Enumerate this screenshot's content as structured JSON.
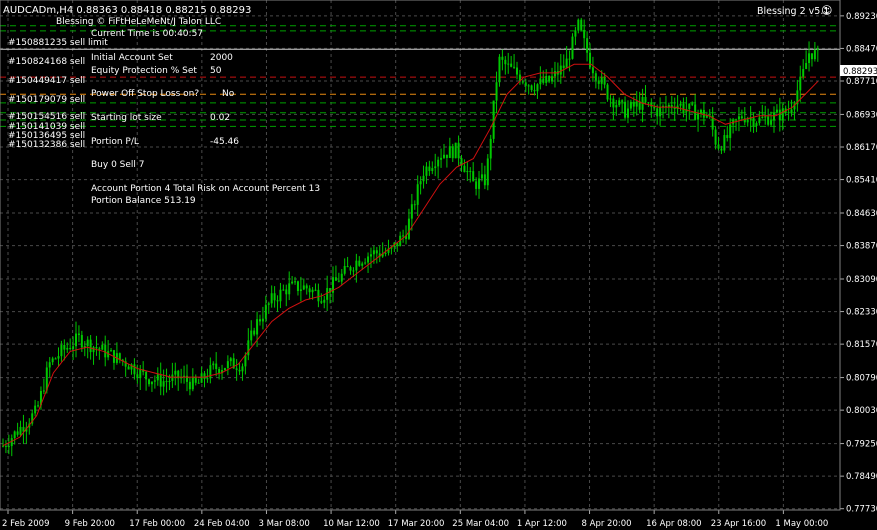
{
  "header": {
    "symbol_line": "AUDCADm,H4  0.88363 0.88418 0.88215 0.88293",
    "ea_credit": "Blessing © FiFtHeLeMeNt/J Talon LLC",
    "ea_name": "Blessing 2 v5.1",
    "smiley": "☺"
  },
  "info_panel": {
    "current_time": "Current Time is      00:40:57",
    "initial_account": "Initial Account Set",
    "initial_account_value": "2000",
    "equity_protection": "Equity Protection % Set",
    "equity_protection_value": "50",
    "power_off": "Power Off Stop Loss on?",
    "power_off_value": "No",
    "starting_lot": "Starting lot size",
    "starting_lot_value": "0.02",
    "portion_pl": "Portion P/L",
    "portion_pl_value": "-45.46",
    "buy_sell": "Buy   0  Sell   7",
    "account_portion": "Account Portion   4    Total Risk on Account Percent  13",
    "portion_balance": "Portion Balance     513.19"
  },
  "orders": [
    "#150881235 sell limit",
    "#150824168 sell",
    "#150449417 sell",
    "#150179079 sell",
    "#150154516 sell",
    "#150141039 sell",
    "#150136495 sell",
    "#150132386 sell"
  ],
  "colors": {
    "background": "#000000",
    "grid": "#4a4a4a",
    "candles": "#00c800",
    "moving_average": "#d01010",
    "text": "#ffffff",
    "order_line_green": "#00a000",
    "order_line_red": "#c81010",
    "order_line_orange": "#e88a10",
    "price_label_bg": "#ffffff"
  },
  "chart_data": {
    "type": "candlestick",
    "symbol": "AUDCADm",
    "timeframe": "H4",
    "ohlc_current": {
      "open": 0.88363,
      "high": 0.88418,
      "low": 0.88215,
      "close": 0.88293
    },
    "current_price_label": "0.88293",
    "ylim": [
      0.777,
      0.896
    ],
    "y_ticks": [
      "0.89230",
      "0.88470",
      "0.87710",
      "0.86930",
      "0.86170",
      "0.85410",
      "0.84630",
      "0.83870",
      "0.83090",
      "0.82330",
      "0.81570",
      "0.80790",
      "0.80030",
      "0.79250",
      "0.78490",
      "0.77730"
    ],
    "x_ticks": [
      "2 Feb 2009",
      "9 Feb 20:00",
      "17 Feb 00:00",
      "24 Feb 04:00",
      "3 Mar 08:00",
      "10 Mar 12:00",
      "17 Mar 20:00",
      "25 Mar 04:00",
      "1 Apr 12:00",
      "8 Apr 20:00",
      "16 Apr 08:00",
      "23 Apr 16:00",
      "1 May 00:00"
    ],
    "trend_path": [
      [
        0,
        0.792
      ],
      [
        0.02,
        0.796
      ],
      [
        0.04,
        0.8
      ],
      [
        0.055,
        0.811
      ],
      [
        0.07,
        0.814
      ],
      [
        0.09,
        0.817
      ],
      [
        0.11,
        0.815
      ],
      [
        0.13,
        0.813
      ],
      [
        0.15,
        0.811
      ],
      [
        0.17,
        0.808
      ],
      [
        0.19,
        0.807
      ],
      [
        0.21,
        0.808
      ],
      [
        0.23,
        0.806
      ],
      [
        0.25,
        0.81
      ],
      [
        0.27,
        0.811
      ],
      [
        0.285,
        0.811
      ],
      [
        0.3,
        0.82
      ],
      [
        0.32,
        0.826
      ],
      [
        0.34,
        0.829
      ],
      [
        0.36,
        0.829
      ],
      [
        0.38,
        0.827
      ],
      [
        0.4,
        0.831
      ],
      [
        0.42,
        0.835
      ],
      [
        0.44,
        0.837
      ],
      [
        0.46,
        0.837
      ],
      [
        0.48,
        0.842
      ],
      [
        0.5,
        0.856
      ],
      [
        0.52,
        0.86
      ],
      [
        0.54,
        0.861
      ],
      [
        0.56,
        0.853
      ],
      [
        0.575,
        0.854
      ],
      [
        0.59,
        0.882
      ],
      [
        0.61,
        0.879
      ],
      [
        0.63,
        0.876
      ],
      [
        0.65,
        0.877
      ],
      [
        0.67,
        0.881
      ],
      [
        0.685,
        0.89
      ],
      [
        0.7,
        0.881
      ],
      [
        0.72,
        0.874
      ],
      [
        0.74,
        0.87
      ],
      [
        0.76,
        0.872
      ],
      [
        0.78,
        0.87
      ],
      [
        0.8,
        0.872
      ],
      [
        0.82,
        0.87
      ],
      [
        0.84,
        0.869
      ],
      [
        0.85,
        0.862
      ],
      [
        0.86,
        0.863
      ],
      [
        0.87,
        0.867
      ],
      [
        0.88,
        0.869
      ],
      [
        0.9,
        0.868
      ],
      [
        0.92,
        0.869
      ],
      [
        0.935,
        0.87
      ],
      [
        0.95,
        0.877
      ],
      [
        0.96,
        0.884
      ],
      [
        0.97,
        0.883
      ]
    ],
    "moving_average": [
      [
        0,
        0.792
      ],
      [
        0.02,
        0.794
      ],
      [
        0.04,
        0.799
      ],
      [
        0.06,
        0.809
      ],
      [
        0.08,
        0.814
      ],
      [
        0.1,
        0.815
      ],
      [
        0.12,
        0.814
      ],
      [
        0.14,
        0.812
      ],
      [
        0.16,
        0.81
      ],
      [
        0.18,
        0.809
      ],
      [
        0.2,
        0.808
      ],
      [
        0.22,
        0.808
      ],
      [
        0.24,
        0.808
      ],
      [
        0.26,
        0.809
      ],
      [
        0.28,
        0.811
      ],
      [
        0.3,
        0.816
      ],
      [
        0.32,
        0.821
      ],
      [
        0.34,
        0.824
      ],
      [
        0.36,
        0.826
      ],
      [
        0.38,
        0.827
      ],
      [
        0.4,
        0.829
      ],
      [
        0.42,
        0.832
      ],
      [
        0.44,
        0.835
      ],
      [
        0.46,
        0.838
      ],
      [
        0.48,
        0.841
      ],
      [
        0.5,
        0.847
      ],
      [
        0.52,
        0.853
      ],
      [
        0.54,
        0.857
      ],
      [
        0.56,
        0.859
      ],
      [
        0.58,
        0.866
      ],
      [
        0.6,
        0.874
      ],
      [
        0.62,
        0.878
      ],
      [
        0.64,
        0.879
      ],
      [
        0.66,
        0.879
      ],
      [
        0.68,
        0.881
      ],
      [
        0.7,
        0.881
      ],
      [
        0.72,
        0.878
      ],
      [
        0.74,
        0.874
      ],
      [
        0.76,
        0.872
      ],
      [
        0.78,
        0.871
      ],
      [
        0.8,
        0.871
      ],
      [
        0.82,
        0.87
      ],
      [
        0.84,
        0.869
      ],
      [
        0.86,
        0.867
      ],
      [
        0.88,
        0.868
      ],
      [
        0.9,
        0.869
      ],
      [
        0.92,
        0.869
      ],
      [
        0.94,
        0.871
      ],
      [
        0.96,
        0.875
      ],
      [
        0.97,
        0.877
      ]
    ],
    "order_lines": [
      {
        "price": 0.89,
        "color": "green",
        "dash": true
      },
      {
        "price": 0.8888,
        "color": "green",
        "dash": true
      },
      {
        "price": 0.8845,
        "color": "white",
        "dash": false
      },
      {
        "price": 0.878,
        "color": "red",
        "dash": true
      },
      {
        "price": 0.874,
        "color": "orange",
        "dash": true
      },
      {
        "price": 0.872,
        "color": "green",
        "dash": true
      },
      {
        "price": 0.8697,
        "color": "green",
        "dash": true
      },
      {
        "price": 0.868,
        "color": "green",
        "dash": true
      },
      {
        "price": 0.8665,
        "color": "green",
        "dash": true
      }
    ]
  }
}
